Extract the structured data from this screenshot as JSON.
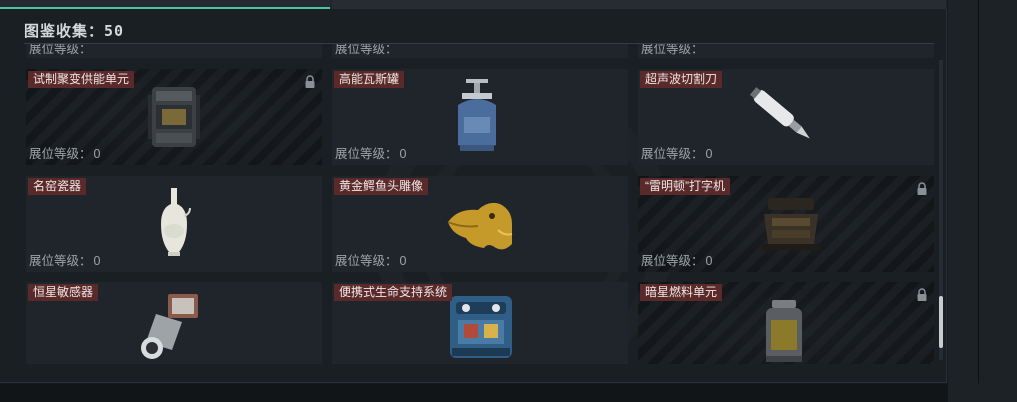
{
  "header": {
    "title_label": "图鉴收集：",
    "count": "50"
  },
  "grade_label": "展位等级：",
  "items": [
    {
      "name": "",
      "grade": "",
      "locked": false,
      "icon": "none"
    },
    {
      "name": "",
      "grade": "",
      "locked": false,
      "icon": "none"
    },
    {
      "name": "",
      "grade": "",
      "locked": false,
      "icon": "none"
    },
    {
      "name": "试制聚变供能单元",
      "grade": "0",
      "locked": true,
      "icon": "fusion-unit-icon"
    },
    {
      "name": "高能瓦斯罐",
      "grade": "0",
      "locked": false,
      "icon": "gas-canister-icon"
    },
    {
      "name": "超声波切割刀",
      "grade": "0",
      "locked": false,
      "icon": "ultrasonic-cutter-icon"
    },
    {
      "name": "名窑瓷器",
      "grade": "0",
      "locked": false,
      "icon": "porcelain-vase-icon"
    },
    {
      "name": "黄金鳄鱼头雕像",
      "grade": "0",
      "locked": false,
      "icon": "golden-crocodile-icon"
    },
    {
      "name": "“雷明顿”打字机",
      "grade": "0",
      "locked": true,
      "icon": "typewriter-icon"
    },
    {
      "name": "恒星敏感器",
      "grade": "",
      "locked": false,
      "icon": "star-sensor-icon"
    },
    {
      "name": "便携式生命支持系统",
      "grade": "",
      "locked": false,
      "icon": "life-support-icon"
    },
    {
      "name": "暗星燃料单元",
      "grade": "",
      "locked": true,
      "icon": "fuel-cell-icon"
    }
  ],
  "colors": {
    "accent": "#4ec3a0",
    "name_tag_bg": "#5a2a2a",
    "panel_bg": "#1a1f24"
  }
}
